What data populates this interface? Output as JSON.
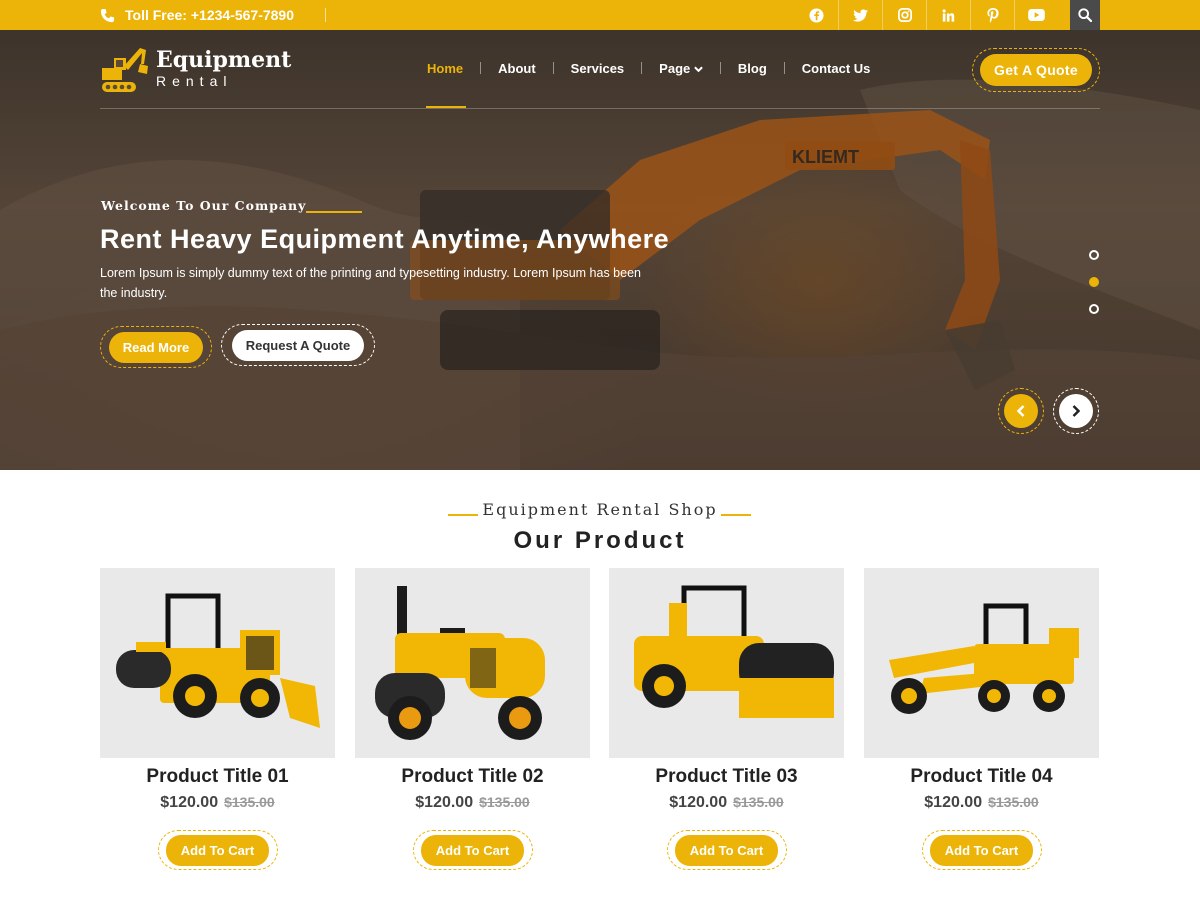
{
  "topbar": {
    "phone": "Toll Free: +1234-567-7890",
    "socials": [
      "facebook-icon",
      "twitter-icon",
      "instagram-icon",
      "linkedin-icon",
      "pinterest-icon",
      "youtube-icon"
    ],
    "social_glyphs": [
      "f",
      "t",
      "◎",
      "in",
      "p",
      "▶"
    ]
  },
  "header": {
    "logo_title": "Equipment",
    "logo_subtitle": "Rental",
    "nav": [
      "Home",
      "About",
      "Services",
      "Page",
      "Blog",
      "Contact Us"
    ],
    "active_nav": "Home",
    "cta": "Get A Quote"
  },
  "hero": {
    "kicker": "Welcome To Our Company",
    "title": "Rent Heavy Equipment Anytime, Anywhere",
    "text": "Lorem Ipsum is simply dummy text of the printing and typesetting industry. Lorem Ipsum has been the industry.",
    "primary_button": "Read More",
    "secondary_button": "Request A Quote",
    "slide_count": 3,
    "active_slide": 2
  },
  "products_section": {
    "subtitle": "Equipment Rental Shop",
    "title": "Our Product",
    "items": [
      {
        "title": "Product Title 01",
        "price": "$120.00",
        "old_price": "$135.00",
        "button": "Add To Cart"
      },
      {
        "title": "Product Title 02",
        "price": "$120.00",
        "old_price": "$135.00",
        "button": "Add To Cart"
      },
      {
        "title": "Product Title 03",
        "price": "$120.00",
        "old_price": "$135.00",
        "button": "Add To Cart"
      },
      {
        "title": "Product Title 04",
        "price": "$120.00",
        "old_price": "$135.00",
        "button": "Add To Cart"
      }
    ]
  },
  "colors": {
    "accent": "#ecb408",
    "dark": "#222222",
    "card_bg": "#e9e9e9"
  }
}
